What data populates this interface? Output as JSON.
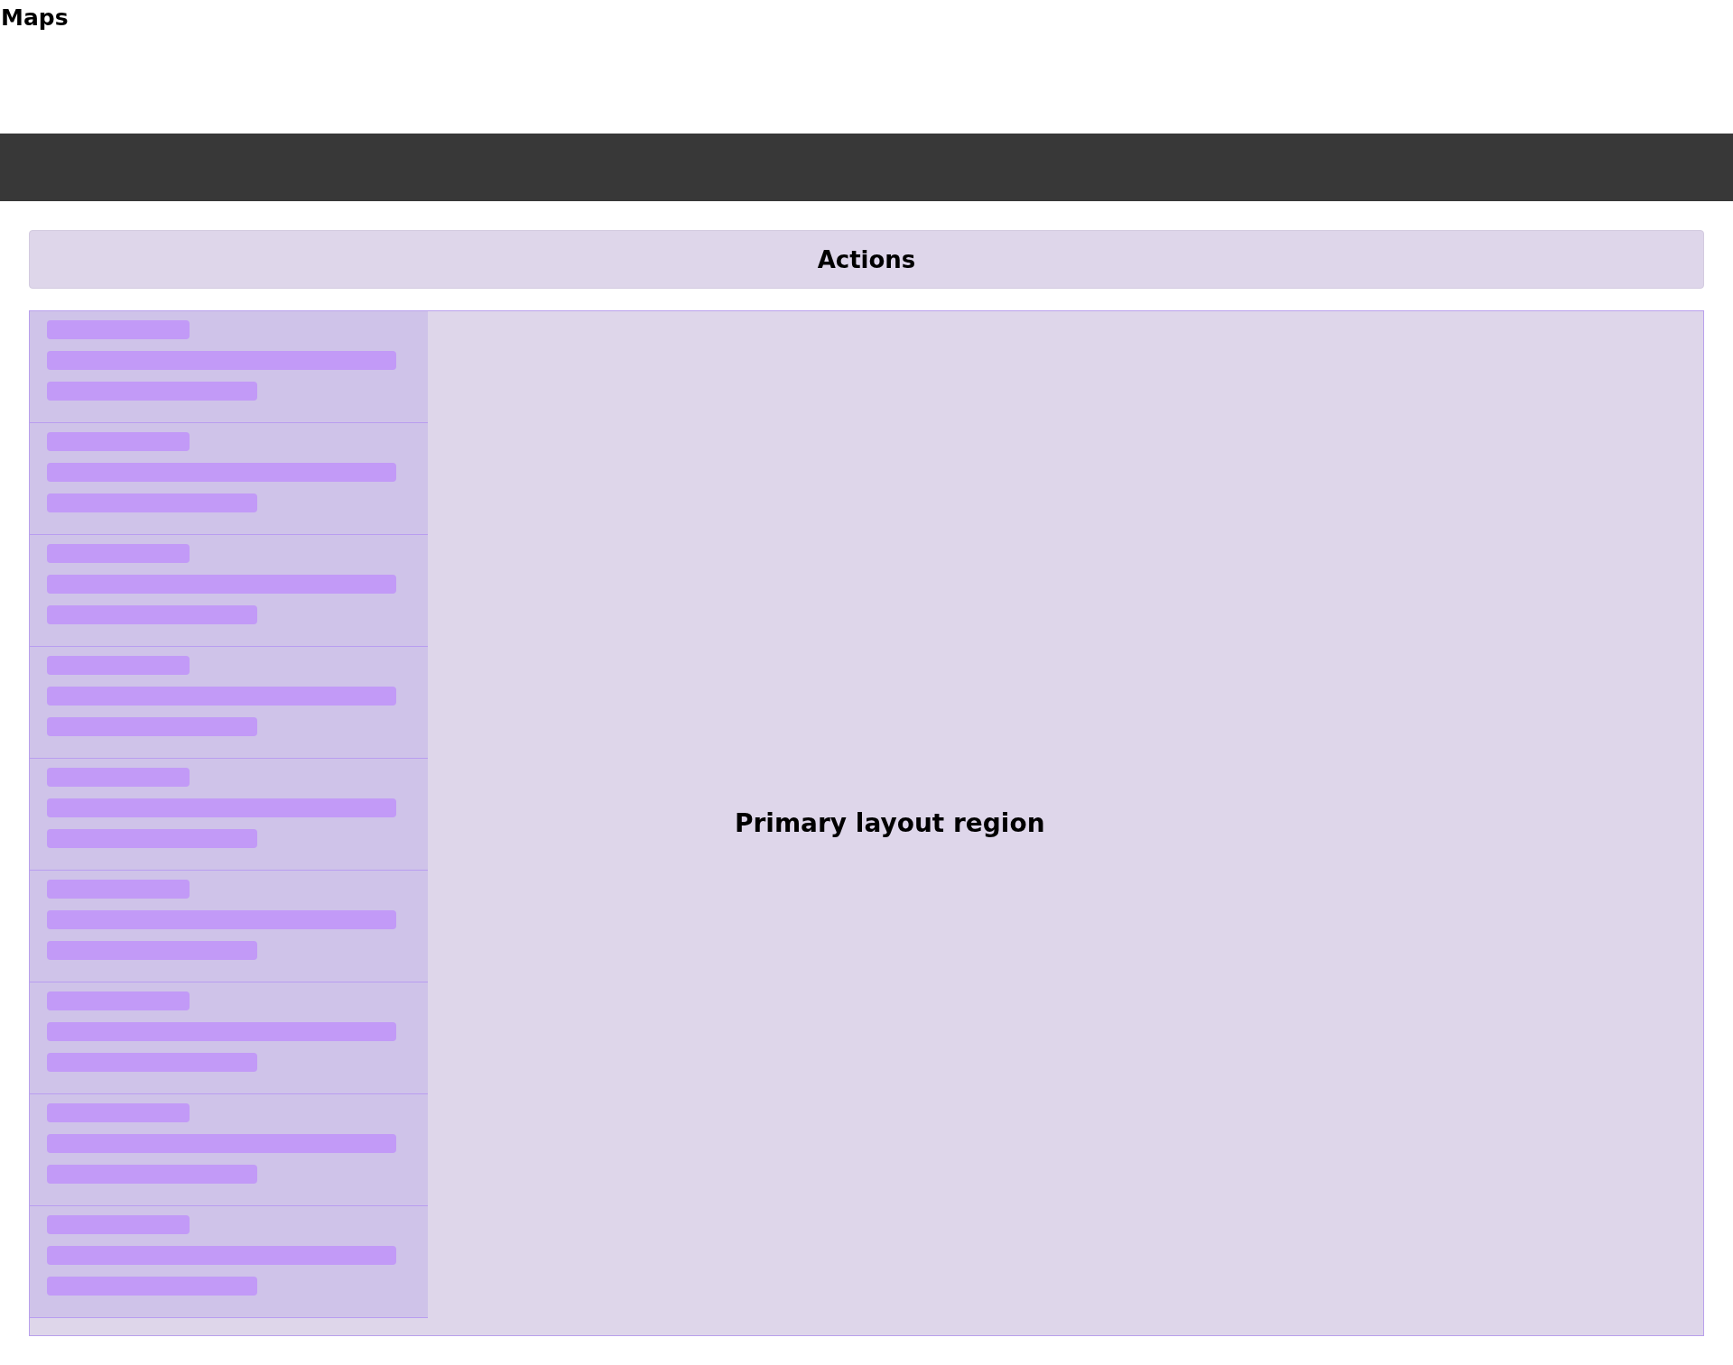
{
  "page": {
    "title": "Maps"
  },
  "actions": {
    "label": "Actions"
  },
  "sidebar": {
    "items": [
      {
        "kind": "skeleton"
      },
      {
        "kind": "skeleton"
      },
      {
        "kind": "skeleton"
      },
      {
        "kind": "skeleton"
      },
      {
        "kind": "skeleton"
      },
      {
        "kind": "skeleton"
      },
      {
        "kind": "skeleton"
      },
      {
        "kind": "skeleton"
      },
      {
        "kind": "skeleton"
      }
    ]
  },
  "main": {
    "label": "Primary layout region"
  }
}
